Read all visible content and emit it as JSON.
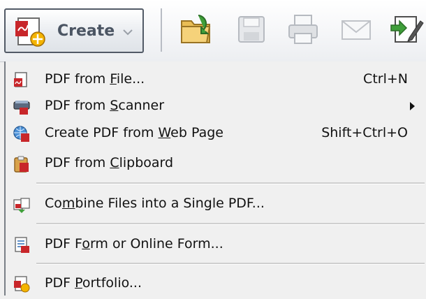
{
  "toolbar": {
    "create_label": "Create",
    "icons": [
      "create-document-icon",
      "open-folder-icon",
      "save-icon",
      "print-icon",
      "email-icon",
      "edit-sign-icon"
    ]
  },
  "menu": {
    "items": [
      {
        "pre": "PDF from ",
        "u": "F",
        "post": "ile...",
        "shortcut": "Ctrl+N",
        "icon": "pdf-from-file-icon"
      },
      {
        "pre": "PDF from ",
        "u": "S",
        "post": "canner",
        "shortcut": "",
        "submenu": true,
        "icon": "scanner-icon"
      },
      {
        "pre": "Create PDF from ",
        "u": "W",
        "post": "eb Page",
        "shortcut": "Shift+Ctrl+O",
        "icon": "web-page-icon"
      },
      {
        "pre": "PDF from ",
        "u": "C",
        "post": "lipboard",
        "shortcut": "",
        "icon": "clipboard-icon"
      },
      {
        "pre": "Co",
        "u": "m",
        "post": "bine Files into a Single PDF...",
        "shortcut": "",
        "icon": "combine-files-icon"
      },
      {
        "pre": "PDF F",
        "u": "o",
        "post": "rm or Online Form...",
        "shortcut": "",
        "icon": "pdf-form-icon"
      },
      {
        "pre": "PDF ",
        "u": "P",
        "post": "ortfolio...",
        "shortcut": "",
        "icon": "portfolio-icon"
      }
    ]
  },
  "colors": {
    "menu_bg": "#f0f0f0",
    "pdf_red": "#c8262a",
    "accent_blue": "#2f6db5",
    "toolbar_green": "#3f9f3a"
  }
}
